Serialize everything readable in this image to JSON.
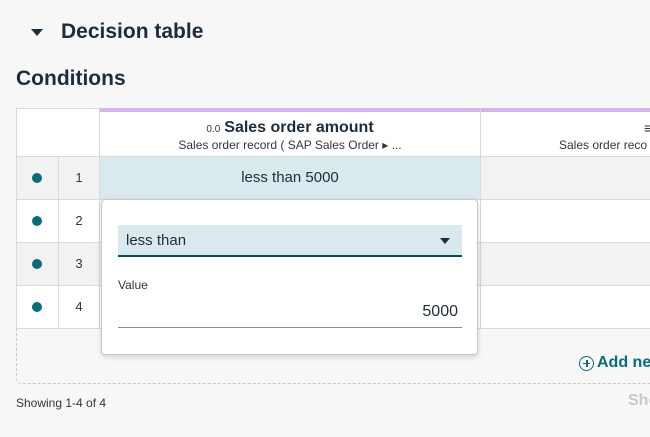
{
  "section": {
    "title": "Decision table"
  },
  "conditions": {
    "title": "Conditions"
  },
  "columns": [
    {
      "type_glyph": "0.0",
      "name": "Sales order amount",
      "source": "Sales order record ( SAP Sales Order ▸ ..."
    },
    {
      "type_glyph": "≡",
      "name": "",
      "source": "Sales order reco"
    }
  ],
  "rows": [
    {
      "num": "1",
      "value": "less than 5000"
    },
    {
      "num": "2",
      "value": ""
    },
    {
      "num": "3",
      "value": ""
    },
    {
      "num": "4",
      "value": ""
    }
  ],
  "popover": {
    "operator": "less than",
    "value_label": "Value",
    "value": "5000"
  },
  "add_row": {
    "label": "Add ne"
  },
  "footer": {
    "showing": "Showing 1-4 of 4",
    "right": "Sho"
  },
  "colors": {
    "accent": "#0a6c7a",
    "column_bar": "#d4b4ea",
    "selected_cell": "#d9e9ee"
  }
}
